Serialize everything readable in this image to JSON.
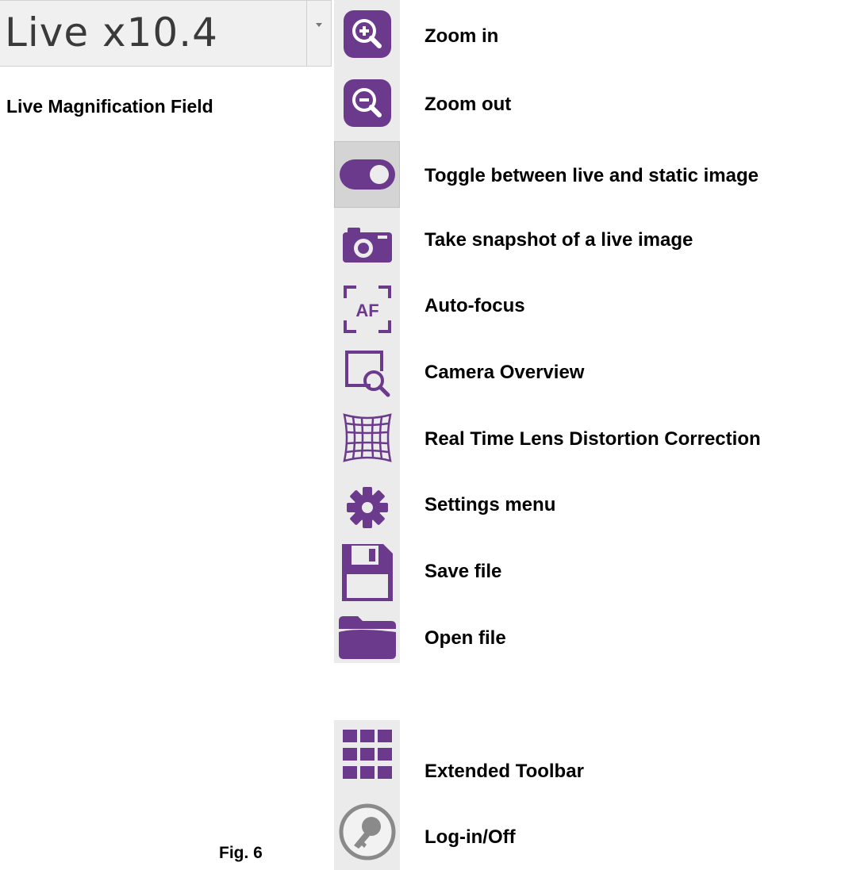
{
  "magnification": {
    "value": "Live x10.4",
    "caption": "Live Magnification Field"
  },
  "colors": {
    "accent": "#6b3a8c",
    "toolbar_bg": "#ebebeb",
    "key_icon": "#7a7a7a"
  },
  "toolbar": {
    "items": [
      {
        "icon": "zoom-in-icon",
        "label": "Zoom in"
      },
      {
        "icon": "zoom-out-icon",
        "label": "Zoom out"
      },
      {
        "icon": "toggle-icon",
        "label": "Toggle between live and static image"
      },
      {
        "icon": "camera-icon",
        "label": "Take snapshot of a live image"
      },
      {
        "icon": "autofocus-icon",
        "label": "Auto-focus"
      },
      {
        "icon": "camera-overview-icon",
        "label": "Camera Overview"
      },
      {
        "icon": "grid-distortion-icon",
        "label": "Real Time Lens Distortion Correction"
      },
      {
        "icon": "gear-icon",
        "label": "Settings menu"
      },
      {
        "icon": "floppy-save-icon",
        "label": "Save file"
      },
      {
        "icon": "folder-open-icon",
        "label": "Open file"
      }
    ]
  },
  "extra": {
    "items": [
      {
        "icon": "apps-grid-icon",
        "label": "Extended Toolbar"
      },
      {
        "icon": "key-icon",
        "label": "Log-in/Off"
      }
    ]
  },
  "figure_label": "Fig. 6"
}
